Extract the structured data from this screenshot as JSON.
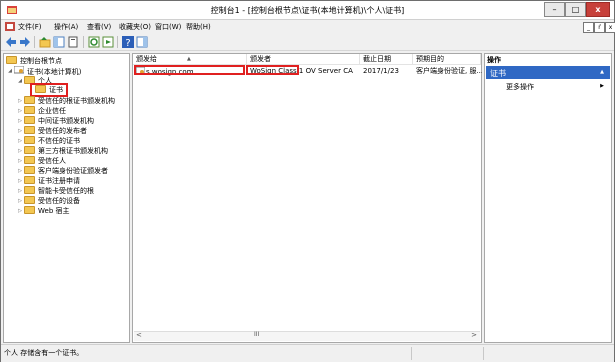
{
  "window": {
    "title": "控制台1 - [控制台根节点\\证书(本地计算机)\\个人\\证书]",
    "minimize": "–",
    "maximize": "□",
    "close": "x"
  },
  "menubar": {
    "items": [
      "文件(F)",
      "操作(A)",
      "查看(V)",
      "收藏夹(O)",
      "窗口(W)",
      "帮助(H)"
    ],
    "mdi": [
      "_",
      "ŕ",
      "x"
    ]
  },
  "tree": {
    "root": "控制台根节点",
    "cert_store": "证书(本地计算机)",
    "personal": "个人",
    "certificates": "证书",
    "stores": [
      "受信任的根证书颁发机构",
      "企业信任",
      "中间证书颁发机构",
      "受信任的发布者",
      "不信任的证书",
      "第三方根证书颁发机构",
      "受信任人",
      "客户端身份验证颁发者",
      "证书注册申请",
      "智能卡受信任的根",
      "受信任的设备",
      "Web 宿主"
    ]
  },
  "list": {
    "columns": [
      "颁发给",
      "颁发者",
      "截止日期",
      "预期目的"
    ],
    "sort_indicator": "▲",
    "rows": [
      [
        "s.wosign.com",
        "WoSign Class 1 OV Server CA",
        "2017/1/23",
        "客户端身份验证, 服..."
      ]
    ],
    "scroll_left": "<",
    "scroll_mid": "III",
    "scroll_right": ">"
  },
  "actions": {
    "header": "操作",
    "section": "证书",
    "section_arrow": "▲",
    "more": "更多操作",
    "more_arrow": "▶"
  },
  "status": {
    "text": "个人 存储含有一个证书。"
  }
}
